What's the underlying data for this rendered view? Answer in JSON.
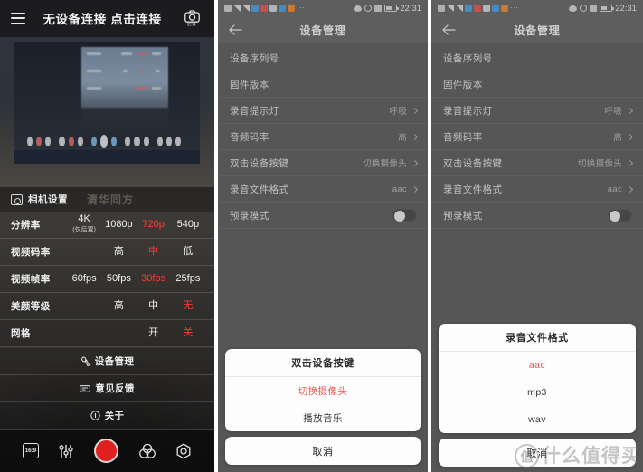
{
  "left_panel": {
    "topbar": {
      "menu_icon": "hamburger-icon",
      "title": "无设备连接  点击连接",
      "camera_icon": "camera-icon",
      "camera_sub": "后置"
    },
    "sheet_header": {
      "icon": "camera-settings-icon",
      "label": "相机设置",
      "watermark": "清华同方"
    },
    "settings_rows": [
      {
        "name": "分辨率",
        "options": [
          {
            "label": "4K",
            "sub": "(仅后置)",
            "selected": false
          },
          {
            "label": "1080p",
            "sub": "",
            "selected": false
          },
          {
            "label": "720p",
            "sub": "",
            "selected": true
          },
          {
            "label": "540p",
            "sub": "",
            "selected": false
          }
        ]
      },
      {
        "name": "视频码率",
        "options": [
          {
            "label": "",
            "sub": "",
            "selected": false,
            "ghost": true
          },
          {
            "label": "高",
            "sub": "",
            "selected": false
          },
          {
            "label": "中",
            "sub": "",
            "selected": true
          },
          {
            "label": "低",
            "sub": "",
            "selected": false
          }
        ]
      },
      {
        "name": "视频帧率",
        "options": [
          {
            "label": "60fps",
            "sub": "",
            "selected": false
          },
          {
            "label": "50fps",
            "sub": "",
            "selected": false
          },
          {
            "label": "30fps",
            "sub": "",
            "selected": true
          },
          {
            "label": "25fps",
            "sub": "",
            "selected": false
          }
        ]
      },
      {
        "name": "美颜等级",
        "options": [
          {
            "label": "",
            "sub": "",
            "selected": false,
            "ghost": true
          },
          {
            "label": "高",
            "sub": "",
            "selected": false
          },
          {
            "label": "中",
            "sub": "",
            "selected": false
          },
          {
            "label": "无",
            "sub": "",
            "selected": true
          }
        ]
      },
      {
        "name": "网格",
        "options": [
          {
            "label": "",
            "sub": "",
            "selected": false,
            "ghost": true
          },
          {
            "label": "",
            "sub": "",
            "selected": false,
            "ghost": true
          },
          {
            "label": "开",
            "sub": "",
            "selected": false
          },
          {
            "label": "关",
            "sub": "",
            "selected": true
          }
        ]
      }
    ],
    "menu_items": [
      {
        "icon": "wrench-icon",
        "label": "设备管理"
      },
      {
        "icon": "feedback-icon",
        "label": "意见反馈"
      },
      {
        "icon": "info-icon",
        "label": "关于"
      }
    ],
    "toolbar": [
      {
        "icon": "aspect-ratio-icon",
        "label": "16:9"
      },
      {
        "icon": "sliders-icon",
        "label": ""
      },
      {
        "icon": "record-button",
        "label": ""
      },
      {
        "icon": "color-filter-icon",
        "label": ""
      },
      {
        "icon": "aperture-icon",
        "label": ""
      }
    ]
  },
  "status_bar": {
    "left_icons": [
      "sim-icon",
      "signal-icon",
      "wifi-icon",
      "app-blue-icon",
      "app-red-icon",
      "cloud-icon",
      "app-blue2-icon",
      "app-orange-icon"
    ],
    "overflow": "···",
    "right_icons": [
      "eye-icon",
      "alarm-icon",
      "mute-icon"
    ],
    "battery": "battery-icon",
    "time": "22:31"
  },
  "app_bar": {
    "back_icon": "back-arrow-icon",
    "title": "设备管理"
  },
  "device_settings": {
    "rows": [
      {
        "name": "设备序列号",
        "value": "",
        "type": "text"
      },
      {
        "name": "固件版本",
        "value": "",
        "type": "text"
      },
      {
        "name": "录音提示灯",
        "value": "呼吸",
        "type": "chevron"
      },
      {
        "name": "音频码率",
        "value": "高",
        "type": "chevron"
      },
      {
        "name": "双击设备按键",
        "value": "切换摄像头",
        "type": "chevron"
      },
      {
        "name": "录音文件格式",
        "value": "aac",
        "type": "chevron"
      },
      {
        "name": "预录模式",
        "value": "off",
        "type": "toggle"
      }
    ]
  },
  "mid_dialog": {
    "title": "双击设备按键",
    "items": [
      {
        "label": "切换摄像头",
        "selected": true
      },
      {
        "label": "播放音乐",
        "selected": false
      }
    ],
    "cancel": "取消"
  },
  "right_dialog": {
    "title": "录音文件格式",
    "items": [
      {
        "label": "aac",
        "selected": true
      },
      {
        "label": "mp3",
        "selected": false
      },
      {
        "label": "wav",
        "selected": false
      }
    ],
    "cancel": "取消"
  },
  "watermark": {
    "mark": "值",
    "text": "什么值得买"
  },
  "colors": {
    "accent_red": "#ff3b30",
    "dialog_selected": "#f1554f",
    "panel_bg": "#616161",
    "topbar_bg": "#1c1c1e",
    "status_bg": "#6b6b6b",
    "record_red": "#e02020"
  }
}
